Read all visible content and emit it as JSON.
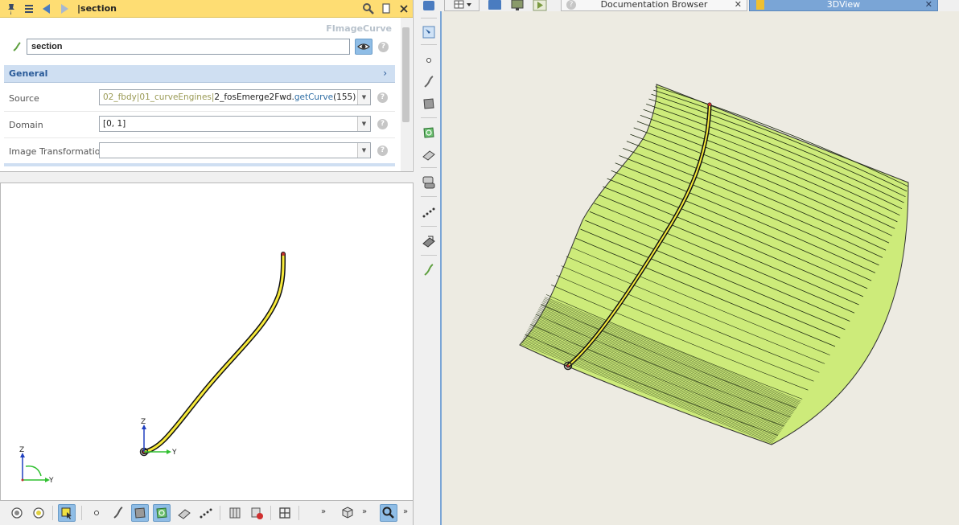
{
  "properties": {
    "title": "section",
    "class_name": "FImageCurve",
    "name_value": "section",
    "group_label": "General",
    "rows": [
      {
        "label": "Source",
        "value_parts": [
          "02_fbdy|01_curveEngines|",
          "2_fosEmerge2Fwd.",
          "getCurve",
          "(155)"
        ]
      },
      {
        "label": "Domain",
        "value": "[0, 1]"
      },
      {
        "label": "Image Transformation",
        "value": ""
      }
    ],
    "help_glyph": "?"
  },
  "view2d": {
    "axis_z": "Z",
    "axis_y": "Y",
    "triad_z": "Z",
    "triad_y": "Y"
  },
  "toolbar_more": "»",
  "tabs": {
    "documentation": "Documentation Browser",
    "view3d": "3DView",
    "close_glyph": "✕"
  },
  "icons": {
    "header": [
      "pin-icon",
      "menu-icon",
      "back-icon",
      "forward-icon",
      "find-icon",
      "copy-icon",
      "close-icon"
    ],
    "vertical_toolbar": [
      "object-tree-icon",
      "view-icon",
      "point-icon",
      "curve-icon",
      "surface-icon",
      "image-surface-icon",
      "solid-icon",
      "fillet-icon",
      "points-icon",
      "trim-icon",
      "curve-tool-icon"
    ],
    "bottom_toolbar": [
      "snap-icon",
      "snap-center-icon",
      "select-icon",
      "point-icon",
      "curve-icon",
      "surface-icon",
      "image-surface-icon",
      "solid-icon",
      "points-icon",
      "section-icon",
      "delete-icon",
      "grid-icon",
      "cube-icon",
      "zoom-icon"
    ]
  },
  "colors": {
    "header_yellow": "#fedd73",
    "accent_blue": "#7aa5d6",
    "curve_yellow": "#f7ea3a",
    "surface_green": "#cdeb7a",
    "group_text": "#2a5b99"
  }
}
